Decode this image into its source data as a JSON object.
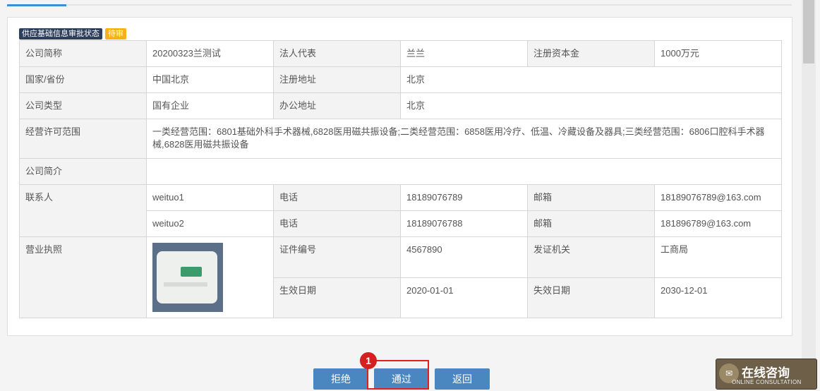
{
  "status": {
    "label": "供应基础信息审批状态",
    "badge": "待审"
  },
  "info": {
    "company_short_label": "公司简称",
    "company_short": "20200323兰测试",
    "legal_rep_label": "法人代表",
    "legal_rep": "兰兰",
    "capital_label": "注册资本金",
    "capital": "1000万元",
    "province_label": "国家/省份",
    "province": "中国北京",
    "reg_address_label": "注册地址",
    "reg_address": "北京",
    "company_type_label": "公司类型",
    "company_type": "国有企业",
    "office_address_label": "办公地址",
    "office_address": "北京",
    "scope_label": "经营许可范围",
    "scope": "一类经营范围：6801基础外科手术器械,6828医用磁共振设备;二类经营范围：6858医用冷疗、低温、冷藏设备及器具;三类经营范围：6806口腔科手术器械,6828医用磁共振设备",
    "intro_label": "公司简介",
    "intro": "",
    "contact_label": "联系人",
    "contacts": [
      {
        "name": "weituo1",
        "phone_label": "电话",
        "phone": "18189076789",
        "email_label": "邮箱",
        "email": "18189076789@163.com"
      },
      {
        "name": "weituo2",
        "phone_label": "电话",
        "phone": "18189076788",
        "email_label": "邮箱",
        "email": "181896789@163.com"
      }
    ],
    "license_label": "营业执照",
    "cert_no_label": "证件编号",
    "cert_no": "4567890",
    "issuer_label": "发证机关",
    "issuer": "工商局",
    "start_label": "生效日期",
    "start_date": "2020-01-01",
    "end_label": "失效日期",
    "end_date": "2030-12-01"
  },
  "buttons": {
    "reject": "拒绝",
    "approve": "通过",
    "back": "返回"
  },
  "annotation": {
    "number": "1"
  },
  "chat_widget": {
    "title": "在线咨询",
    "subtitle": "ONLINE CONSULTATION"
  }
}
